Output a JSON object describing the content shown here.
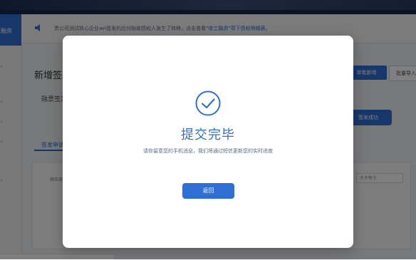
{
  "sidebar": {
    "active_label": "融资"
  },
  "notice": {
    "text_before": "贵公司测试核心企业wn签发的应付账款债权人发生了转移，点击查看",
    "link": "\"徐工融资\"项下债权明细表",
    "text_after": "。"
  },
  "background": {
    "page_title": "新增签发",
    "sub_label": "融票签发",
    "tab_label": "签发申请",
    "column_label": "供应商",
    "single_button": "单笔新增",
    "batch_button": "批量导入",
    "issue_success_button": "签发成功",
    "compare_select": "大于等于"
  },
  "modal": {
    "title": "提交完毕",
    "description": "请你留意您的手机消息，我们将通过短信更新您的实时进度",
    "back_button": "返回"
  },
  "colors": {
    "accent": "#2f6fd6",
    "overlay": "rgba(0,0,0,0.5)"
  }
}
